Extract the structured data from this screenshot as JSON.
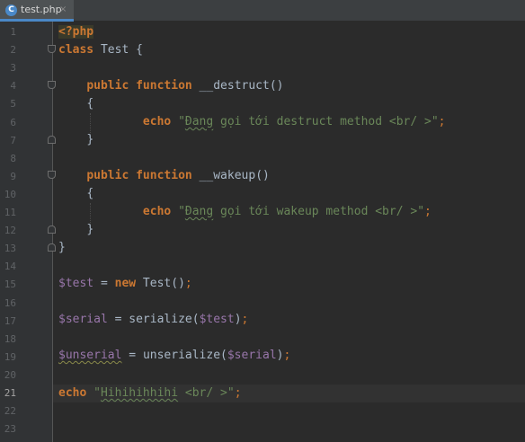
{
  "tab": {
    "icon_letter": "C",
    "label": "test.php",
    "close": "×"
  },
  "line_numbers": [
    "1",
    "2",
    "3",
    "4",
    "5",
    "6",
    "7",
    "8",
    "9",
    "10",
    "11",
    "12",
    "13",
    "14",
    "15",
    "16",
    "17",
    "18",
    "19",
    "20",
    "21",
    "22",
    "23"
  ],
  "active_line": "21",
  "code": {
    "l1": {
      "tag": "<?php"
    },
    "l2": {
      "kw": "class",
      "name": " Test {"
    },
    "l4": {
      "indent": "    ",
      "kw1": "public",
      "kw2": " function",
      "fn": " __destruct",
      "rest": "()"
    },
    "l5": {
      "indent": "    ",
      "text": "{"
    },
    "l6": {
      "indent": "            ",
      "kw": "echo",
      "sp": " ",
      "q1": "\"",
      "word": "Đang",
      "str": " gọi tới destruct method <br/ >",
      "q2": "\"",
      "semi": ";"
    },
    "l7": {
      "indent": "    ",
      "text": "}"
    },
    "l9": {
      "indent": "    ",
      "kw1": "public",
      "kw2": " function",
      "fn": " __wakeup",
      "rest": "()"
    },
    "l10": {
      "indent": "    ",
      "text": "{"
    },
    "l11": {
      "indent": "            ",
      "kw": "echo",
      "sp": " ",
      "q1": "\"",
      "word": "Đang",
      "str": " gọi tới wakeup method <br/ >",
      "q2": "\"",
      "semi": ";"
    },
    "l12": {
      "indent": "    ",
      "text": "}"
    },
    "l13": {
      "text": "}"
    },
    "l15": {
      "var": "$test",
      "eq": " = ",
      "kw": "new",
      "rest": " Test()",
      "semi": ";"
    },
    "l17": {
      "var": "$serial",
      "eq": " = ",
      "fn": "serialize(",
      "arg": "$test",
      "close": ")",
      "semi": ";"
    },
    "l19": {
      "var": "$unserial",
      "eq": " = ",
      "fn": "unserialize(",
      "arg": "$serial",
      "close": ")",
      "semi": ";"
    },
    "l21": {
      "kw": "echo",
      "sp": " ",
      "q1": "\"",
      "word": "Hihihihhihi",
      "str": " <br/ >",
      "q2": "\"",
      "semi": ";"
    }
  },
  "colors": {
    "background": "#2b2b2b",
    "gutter": "#313335",
    "keyword": "#cc7832",
    "string": "#6a8759",
    "variable": "#9876aa",
    "text": "#a9b7c6",
    "tab_accent": "#4a88c7"
  }
}
